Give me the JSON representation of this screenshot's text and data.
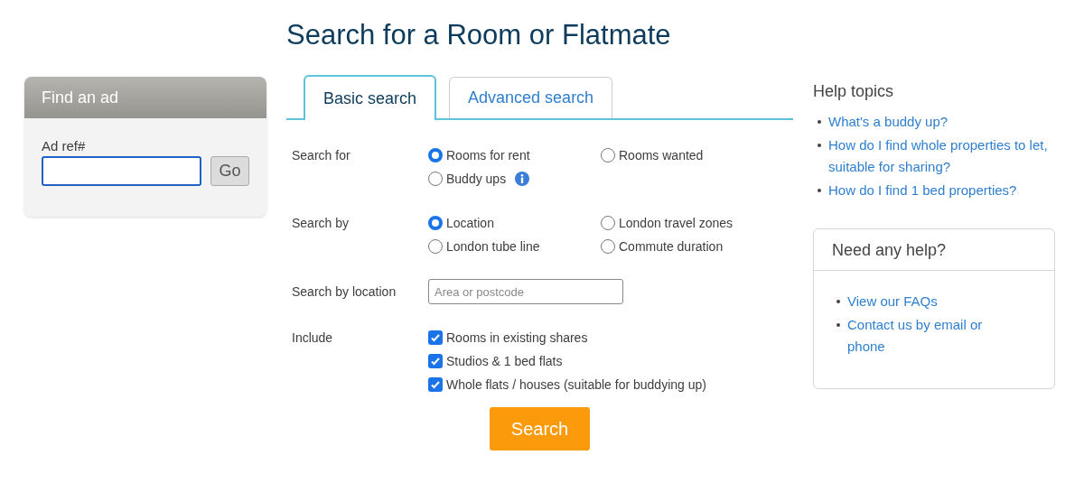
{
  "title": "Search for a Room or Flatmate",
  "find_ad": {
    "header": "Find an ad",
    "label": "Ad ref#",
    "button": "Go"
  },
  "tabs": [
    {
      "label": "Basic search",
      "selected": true
    },
    {
      "label": "Advanced search",
      "selected": false
    }
  ],
  "form": [
    {
      "kind": "radio",
      "label": "Search for",
      "options": [
        {
          "label": "Rooms for rent",
          "selected": true
        },
        {
          "label": "Rooms wanted",
          "selected": false
        },
        {
          "label": "Buddy ups",
          "selected": false,
          "info": true
        }
      ]
    },
    {
      "kind": "radio",
      "label": "Search by",
      "options": [
        {
          "label": "Location",
          "selected": true
        },
        {
          "label": "London travel zones",
          "selected": false
        },
        {
          "label": "London tube line",
          "selected": false
        },
        {
          "label": "Commute duration",
          "selected": false
        }
      ]
    },
    {
      "kind": "text",
      "label": "Search by location",
      "placeholder": "Area or postcode"
    },
    {
      "kind": "checkbox",
      "label": "Include",
      "options": [
        {
          "label": "Rooms in existing shares",
          "checked": true
        },
        {
          "label": "Studios & 1 bed flats",
          "checked": true
        },
        {
          "label": "Whole flats / houses (suitable for buddying up)",
          "checked": true
        }
      ]
    }
  ],
  "search_button": "Search",
  "help_topics": {
    "title": "Help topics",
    "links": [
      "What's a buddy up?",
      "How do I find whole properties to let, suitable for sharing?",
      "How do I find 1 bed properties?"
    ]
  },
  "help_box": {
    "title": "Need any help?",
    "links": [
      "View our FAQs",
      "Contact us by email or phone"
    ]
  }
}
